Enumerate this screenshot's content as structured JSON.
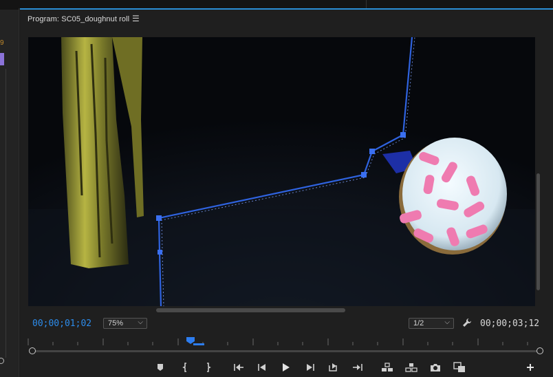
{
  "panel": {
    "title": "Program: SC05_doughnut roll",
    "menu_glyph": "☰"
  },
  "left_panel": {
    "fragment_text": "9"
  },
  "viewer": {
    "current_timecode": "00;00;01;02",
    "duration_timecode": "00;00;03;12",
    "zoom": "75%",
    "resolution": "1/2",
    "dropdown_chevron": "⌵"
  },
  "colors": {
    "accent": "#2d8ceb",
    "mask_path": "#2f63e0",
    "panel_border": "#2a8fd6",
    "sprinkles": "#ef7bb0",
    "frosting": "#e9f2f7"
  },
  "transport": {
    "buttons": [
      "add-marker-icon",
      "mark-in-icon",
      "mark-out-icon",
      "go-to-in-icon",
      "step-back-icon",
      "play-icon",
      "step-forward-icon",
      "go-to-out-icon",
      "lift-icon",
      "extract-icon",
      "export-frame-icon",
      "comparison-view-icon",
      "button-editor-icon"
    ]
  }
}
